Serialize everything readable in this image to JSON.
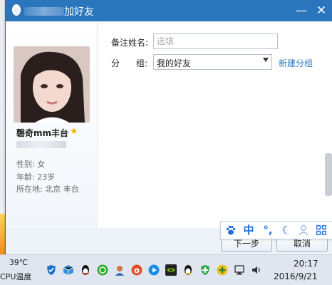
{
  "window": {
    "title_visible": "加好友",
    "minimize_glyph": "—",
    "close_glyph": "✕"
  },
  "profile": {
    "nickname": "磬奇mm丰台",
    "gender": "性别: 女",
    "age": "年龄: 23岁",
    "location": "所在地: 北京 丰台"
  },
  "form": {
    "remark_label": "备注姓名:",
    "remark_placeholder": "选填",
    "group_label_a": "分",
    "group_label_b": "组:",
    "group_value": "我的好友",
    "new_group_link": "新建分组"
  },
  "buttons": {
    "next": "下一步",
    "cancel": "取消"
  },
  "ime": {
    "mode": "中",
    "punct": "°,"
  },
  "taskbar": {
    "temperature": "39℃",
    "cpu_label": "CPU温度",
    "time": "20:17",
    "date": "2016/9/21"
  },
  "colors": {
    "titlebar": "#2b75bd",
    "link": "#2d7ac0",
    "ime_blue": "#1e6fd8"
  }
}
